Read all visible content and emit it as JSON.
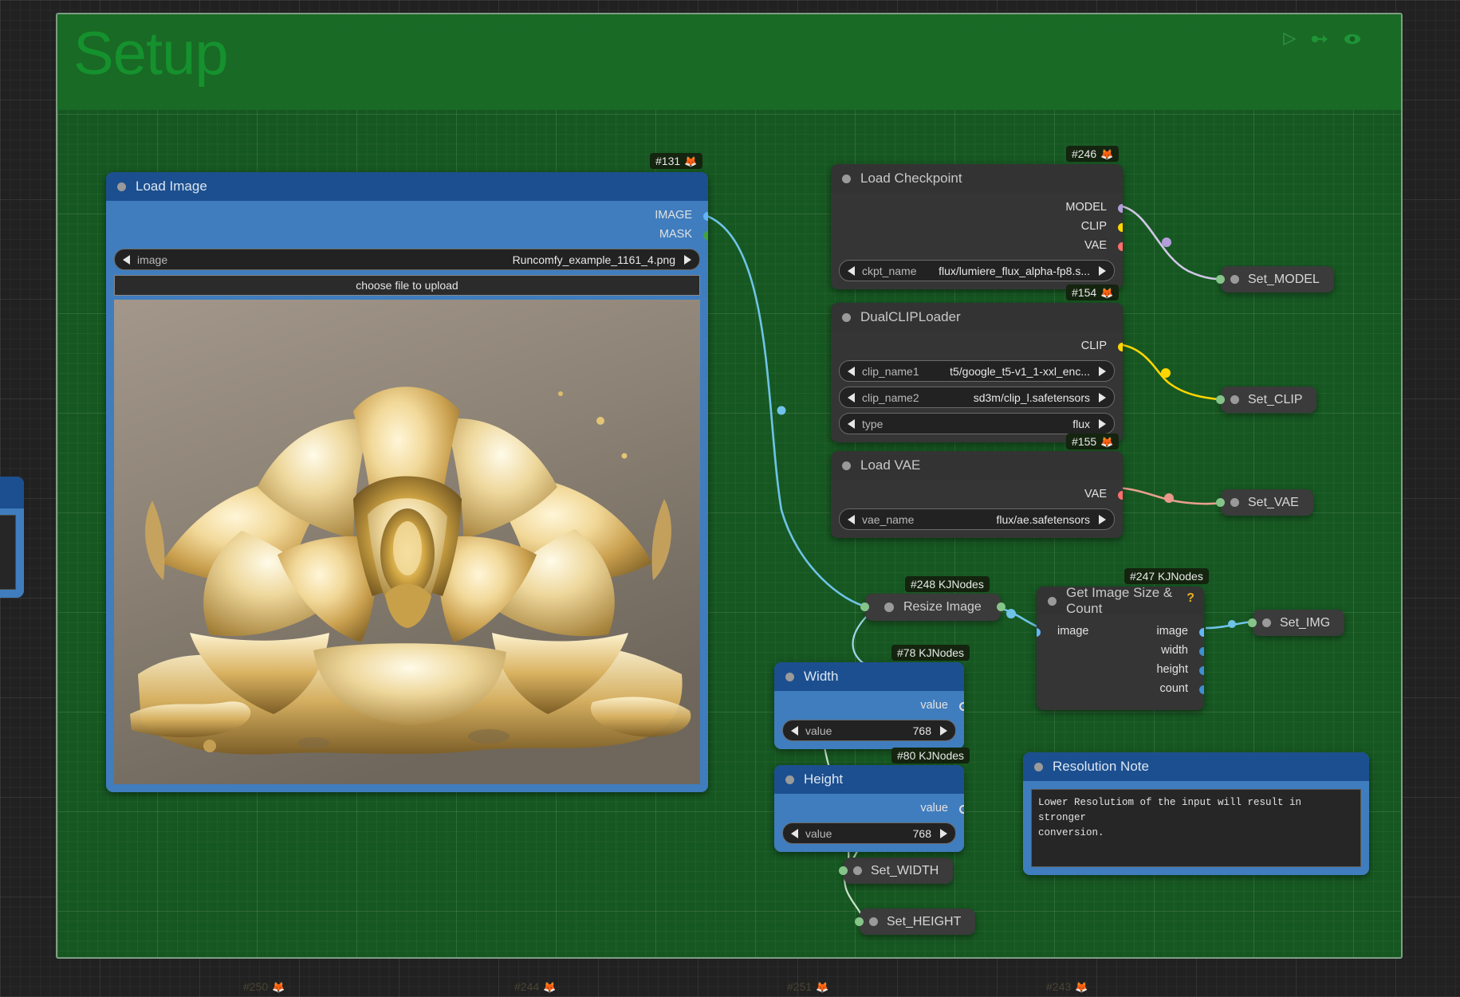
{
  "group": {
    "title": "Setup",
    "tools": [
      "play-icon",
      "link-icon",
      "eye-icon"
    ]
  },
  "colors": {
    "group_bg": "#165c22",
    "group_title": "#15912e",
    "node_dark": "#353535",
    "node_blue": "#3f7dbe",
    "node_blue_header": "#1c4f8f",
    "slot_image": "#64b5f6",
    "slot_mask": "#43a047",
    "slot_model": "#b39ddb",
    "slot_clip": "#ffd500",
    "slot_vae": "#ff6e6e",
    "slot_int": "#86c48a",
    "slot_generic": "#3f8fd2"
  },
  "nodes": {
    "load_image": {
      "badge": "#131",
      "title": "Load Image",
      "outputs": [
        {
          "label": "IMAGE",
          "color": "#64b5f6"
        },
        {
          "label": "MASK",
          "color": "#43a047"
        }
      ],
      "widget": {
        "label": "image",
        "value": "Runcomfy_example_1161_4.png"
      },
      "upload_button": "choose file to upload"
    },
    "load_checkpoint": {
      "badge": "#246",
      "title": "Load Checkpoint",
      "outputs": [
        {
          "label": "MODEL",
          "color": "#b39ddb"
        },
        {
          "label": "CLIP",
          "color": "#ffd500"
        },
        {
          "label": "VAE",
          "color": "#ff6e6e"
        }
      ],
      "widget": {
        "label": "ckpt_name",
        "value": "flux/lumiere_flux_alpha-fp8.s..."
      }
    },
    "dual_clip_loader": {
      "badge": "#154",
      "title": "DualCLIPLoader",
      "outputs": [
        {
          "label": "CLIP",
          "color": "#ffd500"
        }
      ],
      "widgets": [
        {
          "label": "clip_name1",
          "value": "t5/google_t5-v1_1-xxl_enc..."
        },
        {
          "label": "clip_name2",
          "value": "sd3m/clip_l.safetensors"
        },
        {
          "label": "type",
          "value": "flux"
        }
      ]
    },
    "load_vae": {
      "badge": "#155",
      "title": "Load VAE",
      "outputs": [
        {
          "label": "VAE",
          "color": "#ff6e6e"
        }
      ],
      "widget": {
        "label": "vae_name",
        "value": "flux/ae.safetensors"
      }
    },
    "resize_image": {
      "badge": "#248 KJNodes",
      "title": "Resize Image"
    },
    "get_image_size": {
      "badge": "#247 KJNodes",
      "title": "Get Image Size & Count",
      "help_glyph": "?",
      "inputs": [
        {
          "label": "image",
          "color": "#64b5f6"
        }
      ],
      "outputs": [
        {
          "label": "image",
          "color": "#64b5f6"
        },
        {
          "label": "width",
          "color": "#3f8fd2"
        },
        {
          "label": "height",
          "color": "#3f8fd2"
        },
        {
          "label": "count",
          "color": "#3f8fd2"
        }
      ]
    },
    "width_node": {
      "badge": "#78 KJNodes",
      "title": "Width",
      "output": {
        "label": "value"
      },
      "widget": {
        "label": "value",
        "value": "768"
      }
    },
    "height_node": {
      "badge": "#80 KJNodes",
      "title": "Height",
      "output": {
        "label": "value"
      },
      "widget": {
        "label": "value",
        "value": "768"
      }
    },
    "resolution_note": {
      "title": "Resolution Note",
      "text": "Lower Resolutiom of the input will result in stronger\nconversion."
    }
  },
  "setters": [
    {
      "name": "Set_MODEL"
    },
    {
      "name": "Set_CLIP"
    },
    {
      "name": "Set_VAE"
    },
    {
      "name": "Set_IMG"
    },
    {
      "name": "Set_WIDTH"
    },
    {
      "name": "Set_HEIGHT"
    }
  ],
  "bottom_badges": [
    "#250",
    "#244",
    "#251",
    "#243"
  ]
}
